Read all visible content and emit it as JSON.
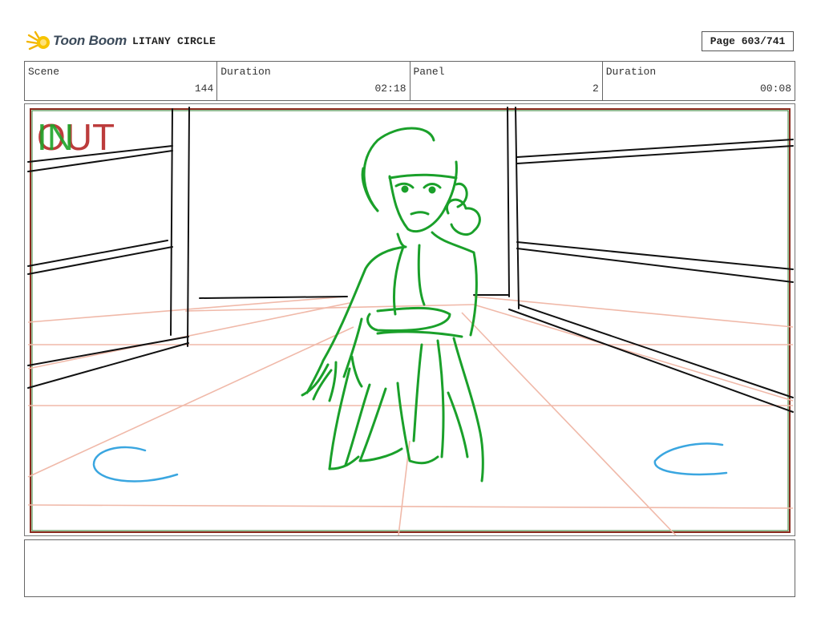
{
  "header": {
    "brand": "Toon Boom",
    "project_title": "LITANY CIRCLE",
    "page_indicator": "Page 603/741"
  },
  "info": {
    "scene_label": "Scene",
    "scene_value": "144",
    "scene_duration_label": "Duration",
    "scene_duration_value": "02:18",
    "panel_label": "Panel",
    "panel_value": "2",
    "panel_duration_label": "Duration",
    "panel_duration_value": "00:08"
  },
  "panel": {
    "in_marker": "IN",
    "out_marker": "OUT",
    "colors": {
      "frame": "#8b2a1e",
      "frame_inner": "#2f7d2f",
      "layout_lines": "#111111",
      "perspective_lines": "#f0b9a9",
      "character": "#1aa02a",
      "props": "#3aa6e0"
    }
  },
  "notes": {
    "text": ""
  }
}
